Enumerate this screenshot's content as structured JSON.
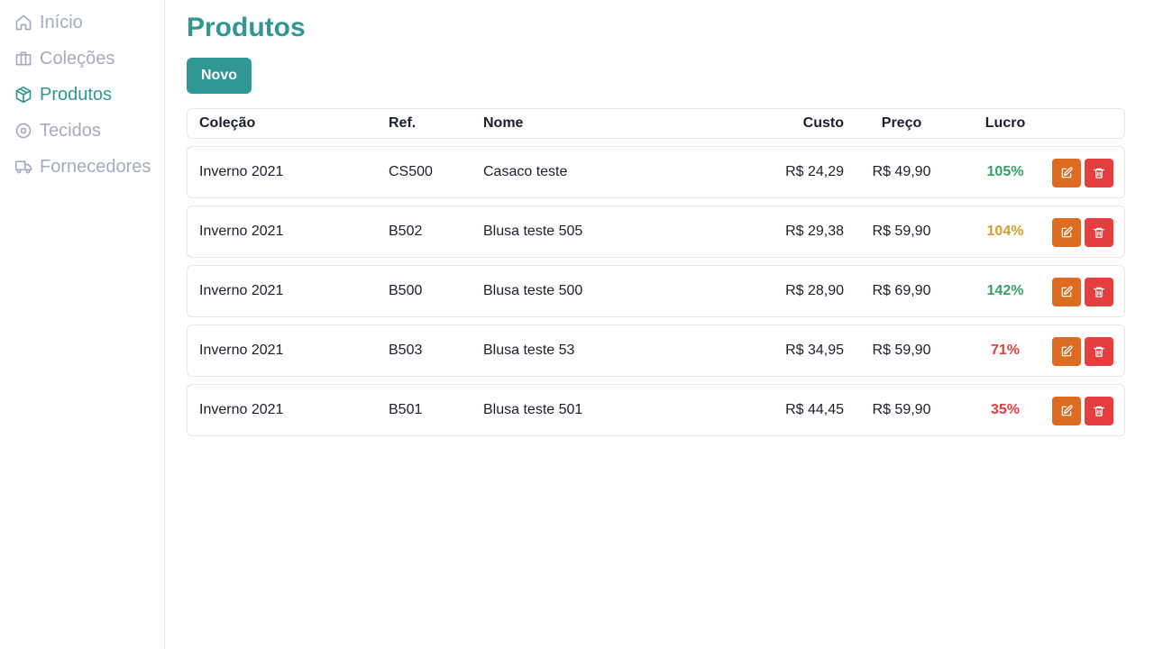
{
  "sidebar": {
    "items": [
      {
        "label": "Início",
        "icon": "home-icon"
      },
      {
        "label": "Coleções",
        "icon": "briefcase-icon"
      },
      {
        "label": "Produtos",
        "icon": "box-icon",
        "active": true
      },
      {
        "label": "Tecidos",
        "icon": "disc-icon"
      },
      {
        "label": "Fornecedores",
        "icon": "truck-icon"
      }
    ]
  },
  "main": {
    "title": "Produtos",
    "new_button_label": "Novo",
    "table": {
      "headers": {
        "collection": "Coleção",
        "ref": "Ref.",
        "name": "Nome",
        "cost": "Custo",
        "price": "Preço",
        "profit": "Lucro"
      },
      "rows": [
        {
          "collection": "Inverno 2021",
          "ref": "CS500",
          "name": "Casaco teste",
          "cost": "R$ 24,29",
          "price": "R$ 49,90",
          "profit": "105%",
          "profit_status": "green"
        },
        {
          "collection": "Inverno 2021",
          "ref": "B502",
          "name": "Blusa teste 505",
          "cost": "R$ 29,38",
          "price": "R$ 59,90",
          "profit": "104%",
          "profit_status": "yellow"
        },
        {
          "collection": "Inverno 2021",
          "ref": "B500",
          "name": "Blusa teste 500",
          "cost": "R$ 28,90",
          "price": "R$ 69,90",
          "profit": "142%",
          "profit_status": "green"
        },
        {
          "collection": "Inverno 2021",
          "ref": "B503",
          "name": "Blusa teste 53",
          "cost": "R$ 34,95",
          "price": "R$ 59,90",
          "profit": "71%",
          "profit_status": "red"
        },
        {
          "collection": "Inverno 2021",
          "ref": "B501",
          "name": "Blusa teste 501",
          "cost": "R$ 44,45",
          "price": "R$ 59,90",
          "profit": "35%",
          "profit_status": "red"
        }
      ],
      "row_actions": {
        "edit_icon": "edit-icon",
        "delete_icon": "trash-icon"
      }
    }
  },
  "colors": {
    "accent": "#319795",
    "nav_inactive": "#a0aec0",
    "edit_button": "#dd6b20",
    "delete_button": "#e53e3e",
    "profit_green": "#38a169",
    "profit_yellow": "#d69e2e",
    "profit_red": "#e53e3e"
  }
}
